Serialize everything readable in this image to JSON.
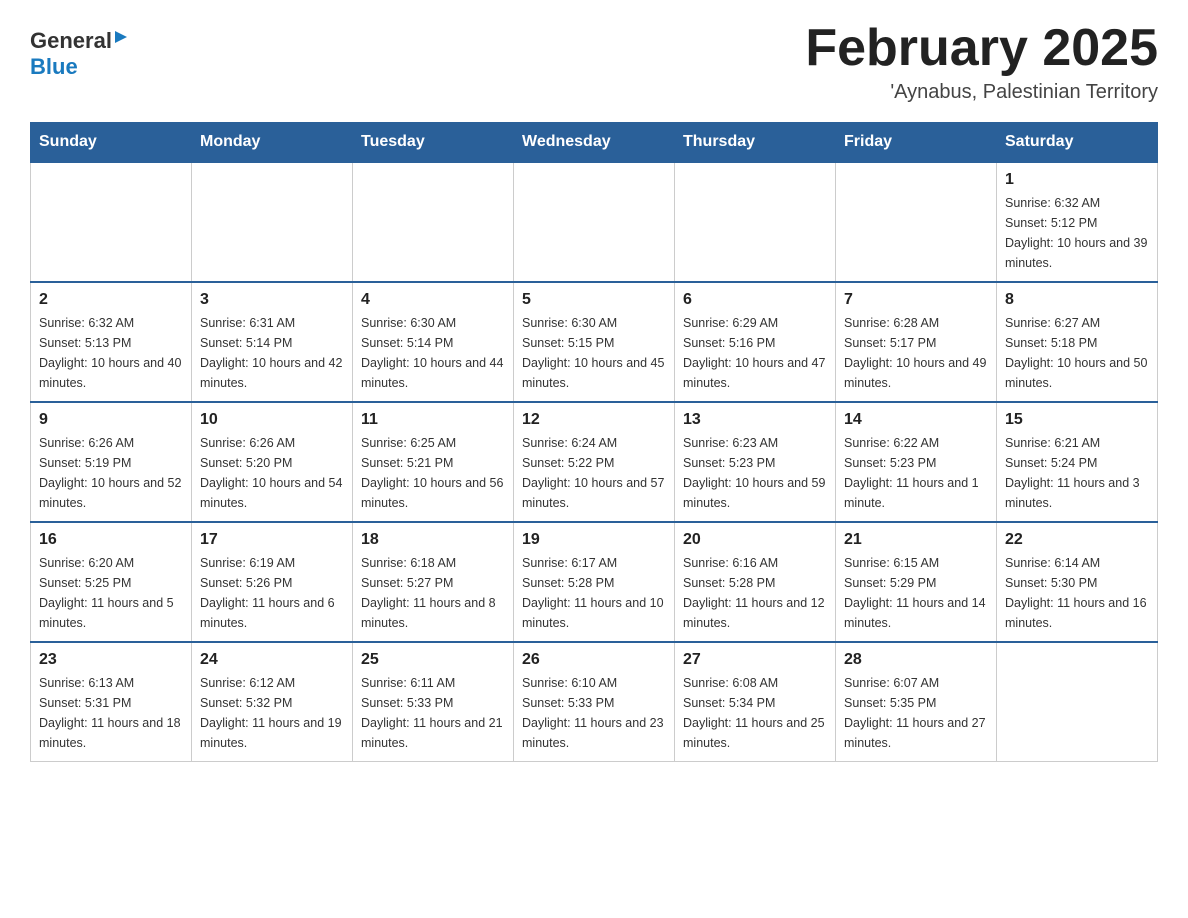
{
  "header": {
    "logo_general": "General",
    "logo_blue": "Blue",
    "month_title": "February 2025",
    "location": "'Aynabus, Palestinian Territory"
  },
  "days_of_week": [
    "Sunday",
    "Monday",
    "Tuesday",
    "Wednesday",
    "Thursday",
    "Friday",
    "Saturday"
  ],
  "weeks": [
    [
      {
        "day": "",
        "info": ""
      },
      {
        "day": "",
        "info": ""
      },
      {
        "day": "",
        "info": ""
      },
      {
        "day": "",
        "info": ""
      },
      {
        "day": "",
        "info": ""
      },
      {
        "day": "",
        "info": ""
      },
      {
        "day": "1",
        "info": "Sunrise: 6:32 AM\nSunset: 5:12 PM\nDaylight: 10 hours and 39 minutes."
      }
    ],
    [
      {
        "day": "2",
        "info": "Sunrise: 6:32 AM\nSunset: 5:13 PM\nDaylight: 10 hours and 40 minutes."
      },
      {
        "day": "3",
        "info": "Sunrise: 6:31 AM\nSunset: 5:14 PM\nDaylight: 10 hours and 42 minutes."
      },
      {
        "day": "4",
        "info": "Sunrise: 6:30 AM\nSunset: 5:14 PM\nDaylight: 10 hours and 44 minutes."
      },
      {
        "day": "5",
        "info": "Sunrise: 6:30 AM\nSunset: 5:15 PM\nDaylight: 10 hours and 45 minutes."
      },
      {
        "day": "6",
        "info": "Sunrise: 6:29 AM\nSunset: 5:16 PM\nDaylight: 10 hours and 47 minutes."
      },
      {
        "day": "7",
        "info": "Sunrise: 6:28 AM\nSunset: 5:17 PM\nDaylight: 10 hours and 49 minutes."
      },
      {
        "day": "8",
        "info": "Sunrise: 6:27 AM\nSunset: 5:18 PM\nDaylight: 10 hours and 50 minutes."
      }
    ],
    [
      {
        "day": "9",
        "info": "Sunrise: 6:26 AM\nSunset: 5:19 PM\nDaylight: 10 hours and 52 minutes."
      },
      {
        "day": "10",
        "info": "Sunrise: 6:26 AM\nSunset: 5:20 PM\nDaylight: 10 hours and 54 minutes."
      },
      {
        "day": "11",
        "info": "Sunrise: 6:25 AM\nSunset: 5:21 PM\nDaylight: 10 hours and 56 minutes."
      },
      {
        "day": "12",
        "info": "Sunrise: 6:24 AM\nSunset: 5:22 PM\nDaylight: 10 hours and 57 minutes."
      },
      {
        "day": "13",
        "info": "Sunrise: 6:23 AM\nSunset: 5:23 PM\nDaylight: 10 hours and 59 minutes."
      },
      {
        "day": "14",
        "info": "Sunrise: 6:22 AM\nSunset: 5:23 PM\nDaylight: 11 hours and 1 minute."
      },
      {
        "day": "15",
        "info": "Sunrise: 6:21 AM\nSunset: 5:24 PM\nDaylight: 11 hours and 3 minutes."
      }
    ],
    [
      {
        "day": "16",
        "info": "Sunrise: 6:20 AM\nSunset: 5:25 PM\nDaylight: 11 hours and 5 minutes."
      },
      {
        "day": "17",
        "info": "Sunrise: 6:19 AM\nSunset: 5:26 PM\nDaylight: 11 hours and 6 minutes."
      },
      {
        "day": "18",
        "info": "Sunrise: 6:18 AM\nSunset: 5:27 PM\nDaylight: 11 hours and 8 minutes."
      },
      {
        "day": "19",
        "info": "Sunrise: 6:17 AM\nSunset: 5:28 PM\nDaylight: 11 hours and 10 minutes."
      },
      {
        "day": "20",
        "info": "Sunrise: 6:16 AM\nSunset: 5:28 PM\nDaylight: 11 hours and 12 minutes."
      },
      {
        "day": "21",
        "info": "Sunrise: 6:15 AM\nSunset: 5:29 PM\nDaylight: 11 hours and 14 minutes."
      },
      {
        "day": "22",
        "info": "Sunrise: 6:14 AM\nSunset: 5:30 PM\nDaylight: 11 hours and 16 minutes."
      }
    ],
    [
      {
        "day": "23",
        "info": "Sunrise: 6:13 AM\nSunset: 5:31 PM\nDaylight: 11 hours and 18 minutes."
      },
      {
        "day": "24",
        "info": "Sunrise: 6:12 AM\nSunset: 5:32 PM\nDaylight: 11 hours and 19 minutes."
      },
      {
        "day": "25",
        "info": "Sunrise: 6:11 AM\nSunset: 5:33 PM\nDaylight: 11 hours and 21 minutes."
      },
      {
        "day": "26",
        "info": "Sunrise: 6:10 AM\nSunset: 5:33 PM\nDaylight: 11 hours and 23 minutes."
      },
      {
        "day": "27",
        "info": "Sunrise: 6:08 AM\nSunset: 5:34 PM\nDaylight: 11 hours and 25 minutes."
      },
      {
        "day": "28",
        "info": "Sunrise: 6:07 AM\nSunset: 5:35 PM\nDaylight: 11 hours and 27 minutes."
      },
      {
        "day": "",
        "info": ""
      }
    ]
  ]
}
